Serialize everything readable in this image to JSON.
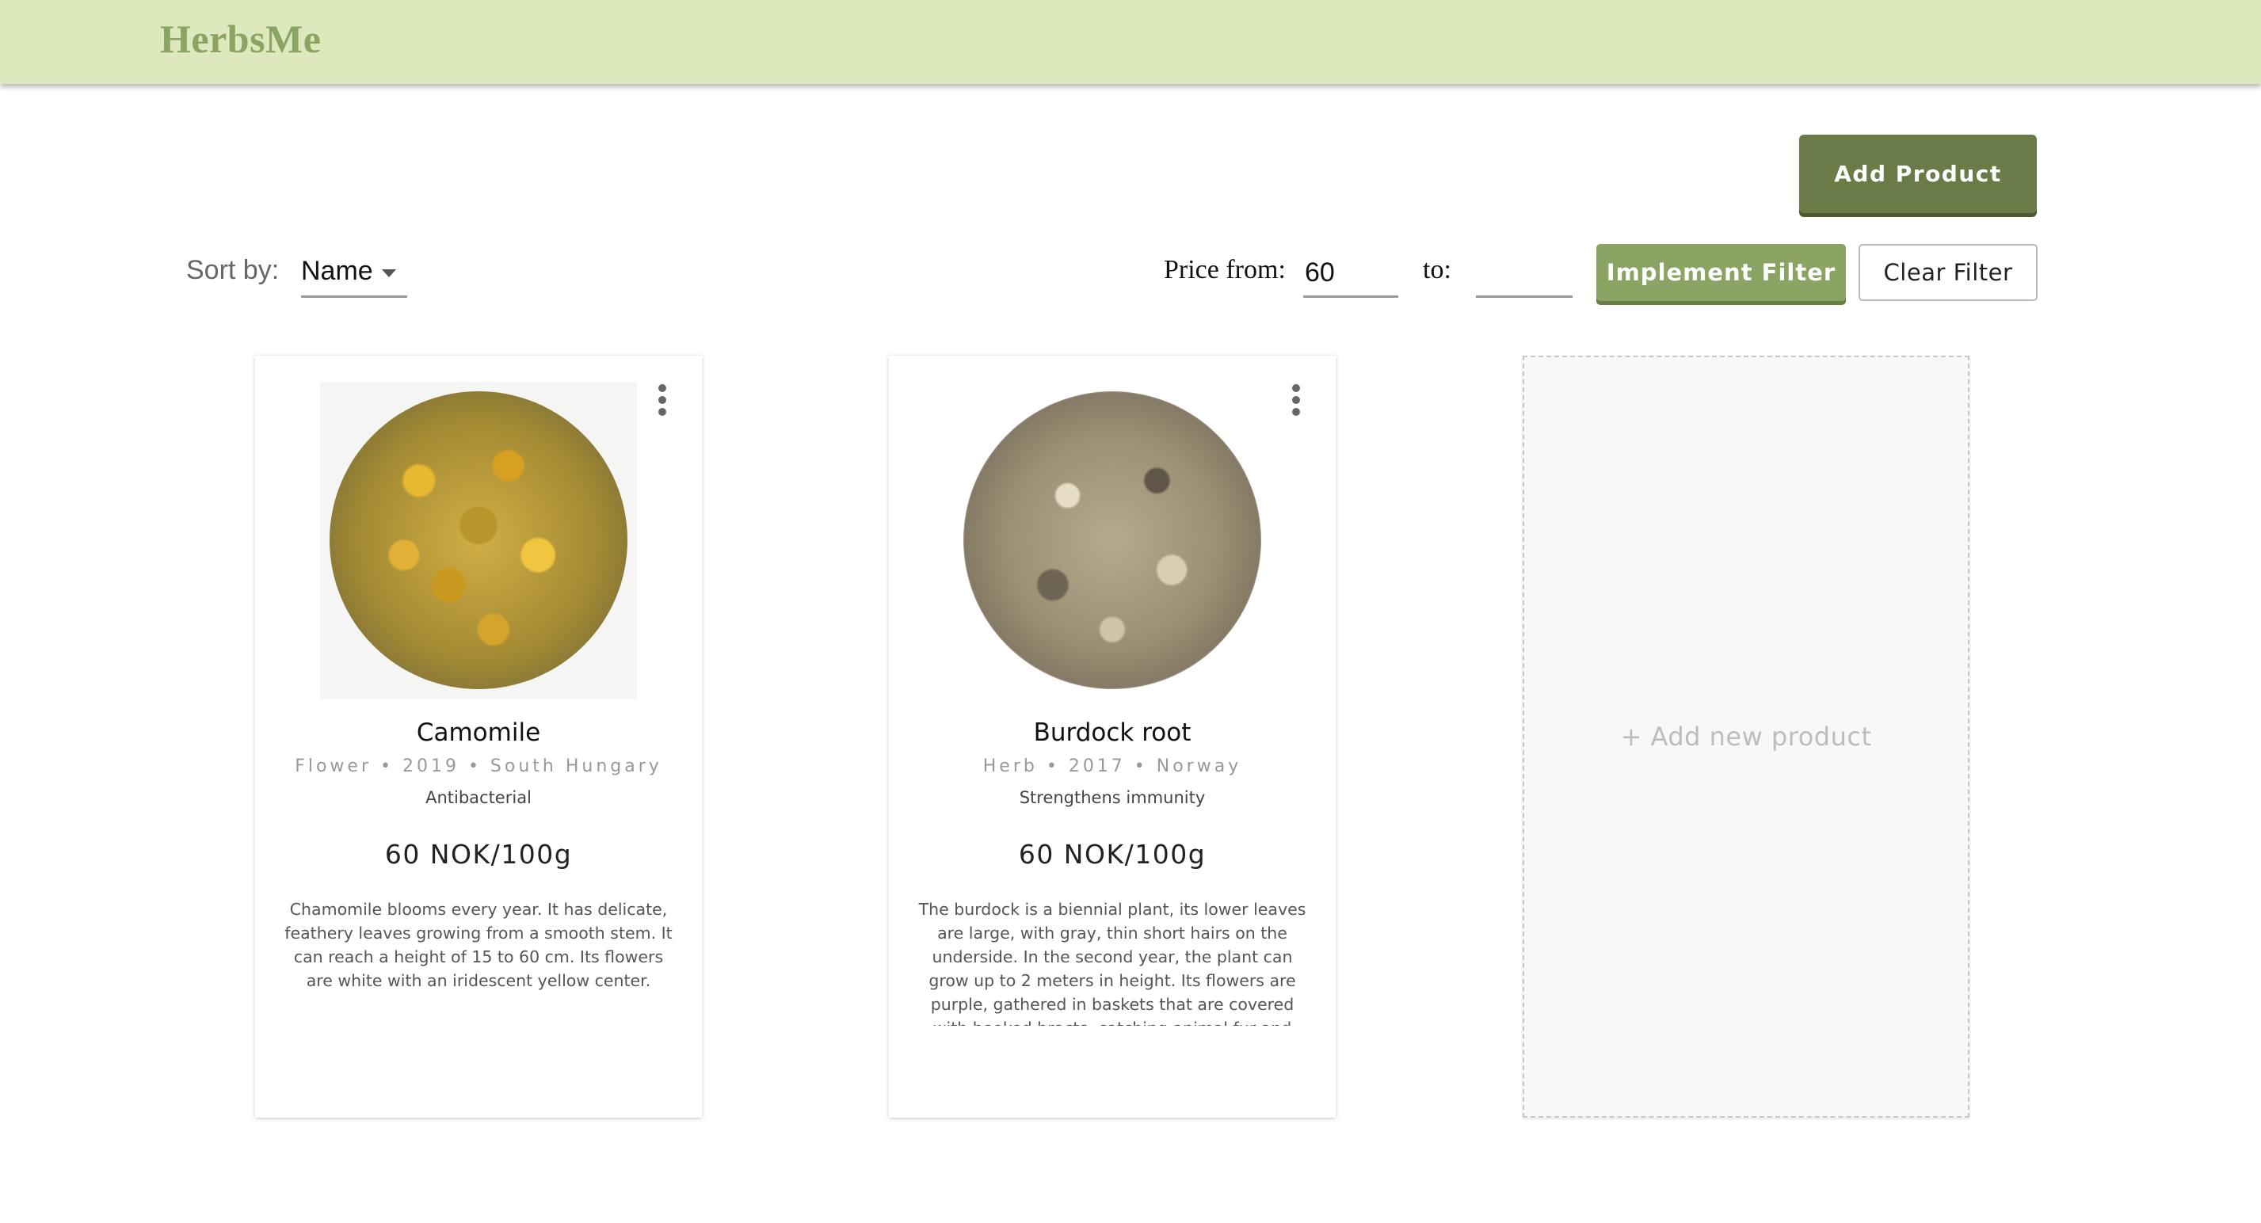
{
  "app": {
    "brand": "HerbsMe"
  },
  "toolbar": {
    "add_product_label": "Add Product",
    "sort_label": "Sort by:",
    "sort_value": "Name",
    "price_from_label": "Price from:",
    "price_from_value": "60",
    "price_to_label": "to:",
    "price_to_value": "",
    "implement_filter_label": "Implement Filter",
    "clear_filter_label": "Clear Filter"
  },
  "products": [
    {
      "name": "Camomile",
      "meta": "Flower • 2019 • South Hungary",
      "property": "Antibacterial",
      "price": "60 NOK/100g",
      "description": "Chamomile blooms every year. It has delicate, feathery leaves growing from a smooth stem. It can reach a height of 15 to 60 cm. Its flowers are white with an iridescent yellow center.",
      "image_icon": "dried-chamomile-image"
    },
    {
      "name": "Burdock root",
      "meta": "Herb • 2017 • Norway",
      "property": "Strengthens immunity",
      "price": "60 NOK/100g",
      "description": "The burdock is a biennial plant, its lower leaves are large, with gray, thin short hairs on the underside. In the second year, the plant can grow up to 2 meters in height. Its flowers are purple, gathered in baskets that are covered with hooked bracts, catching animal fur and clothing. The root can grow quite deep, about",
      "image_icon": "dried-burdock-root-image"
    }
  ],
  "add_new": {
    "label": "+ Add new product"
  },
  "colors": {
    "topbar": "#dde9bd",
    "brand": "#8ba363",
    "primary_dark": "#6a7b47",
    "primary": "#8ba363"
  }
}
